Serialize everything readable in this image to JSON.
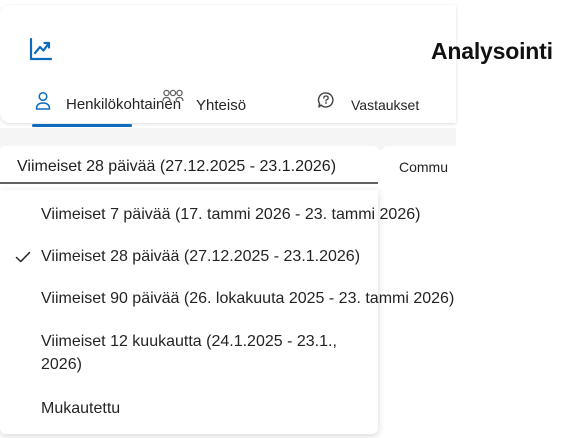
{
  "header": {
    "title": "Analysointi",
    "icon": "trend-chart-icon"
  },
  "tabs": [
    {
      "label": "Henkilökohtainen",
      "icon": "person-icon",
      "selected": true
    },
    {
      "label": "Yhteisö",
      "icon": "people-community-icon",
      "selected": false
    },
    {
      "label": "Vastaukset",
      "icon": "chat-help-icon",
      "selected": false
    }
  ],
  "filters": {
    "date_range": {
      "selected": "Viimeiset 28 päivää (27.12.2025 - 23.1.2026)"
    },
    "community": {
      "label": "Commu"
    }
  },
  "date_options": [
    {
      "label": "Viimeiset 7 päivää (17. tammi 2026 - 23. tammi 2026)",
      "selected": false
    },
    {
      "label": "Viimeiset 28 päivää (27.12.2025 - 23.1.2026)",
      "selected": true
    },
    {
      "label": "Viimeiset 90 päivää (26. lokakuuta 2025 - 23. tammi 2026)",
      "selected": false
    },
    {
      "label": "Viimeiset 12 kuukautta (24.1.2025 - 23.1., 2026)",
      "selected": false
    },
    {
      "label": "Mukautettu",
      "selected": false
    }
  ],
  "colors": {
    "accent": "#0f6cbd",
    "text": "#242424",
    "background": "#ffffff",
    "band": "#f5f5f5"
  }
}
